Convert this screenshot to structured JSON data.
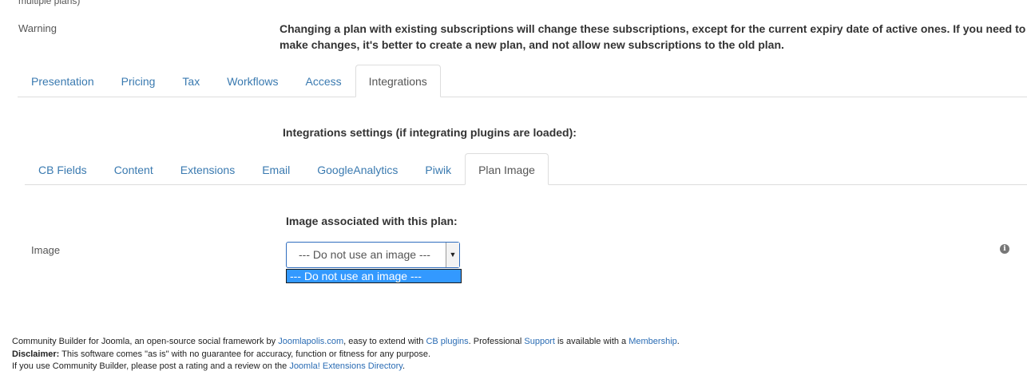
{
  "fields": {
    "cut_off_label": "multiple plans)",
    "warning": {
      "label": "Warning",
      "text": "Changing a plan with existing subscriptions will change these subscriptions, except for the current expiry date of active ones. If you need to make changes, it's better to create a new plan, and not allow new subscriptions to the old plan."
    }
  },
  "main_tabs": [
    {
      "label": "Presentation",
      "active": false
    },
    {
      "label": "Pricing",
      "active": false
    },
    {
      "label": "Tax",
      "active": false
    },
    {
      "label": "Workflows",
      "active": false
    },
    {
      "label": "Access",
      "active": false
    },
    {
      "label": "Integrations",
      "active": true
    }
  ],
  "integrations": {
    "heading": "Integrations settings (if integrating plugins are loaded):",
    "tabs": [
      {
        "label": "CB Fields",
        "active": false
      },
      {
        "label": "Content",
        "active": false
      },
      {
        "label": "Extensions",
        "active": false
      },
      {
        "label": "Email",
        "active": false
      },
      {
        "label": "GoogleAnalytics",
        "active": false
      },
      {
        "label": "Piwik",
        "active": false
      },
      {
        "label": "Plan Image",
        "active": true
      }
    ]
  },
  "plan_image": {
    "heading": "Image associated with this plan:",
    "label": "Image",
    "selected": "--- Do not use an image ---",
    "options": [
      "--- Do not use an image ---"
    ],
    "info_glyph": "i",
    "info_icon": "info-circle-icon"
  },
  "footer": {
    "line1": {
      "t1": "Community Builder for Joomla, an open-source social framework by ",
      "l1": "Joomlapolis.com",
      "t2": ", easy to extend with ",
      "l2": "CB plugins",
      "t3": ". Professional ",
      "l3": "Support",
      "t4": " is available with a ",
      "l4": "Membership",
      "t5": "."
    },
    "line2": {
      "bold": "Disclaimer:",
      "text": " This software comes \"as is\" with no guarantee for accuracy, function or fitness for any purpose."
    },
    "line3": {
      "t1": "If you use Community Builder, please post a rating and a review on the ",
      "link": "Joomla! Extensions Directory",
      "t2": "."
    }
  },
  "colors": {
    "link": "#3a7ab0",
    "tab_border": "#dddddd",
    "select_border": "#2f6dbf",
    "option_highlight": "#3399ff"
  }
}
